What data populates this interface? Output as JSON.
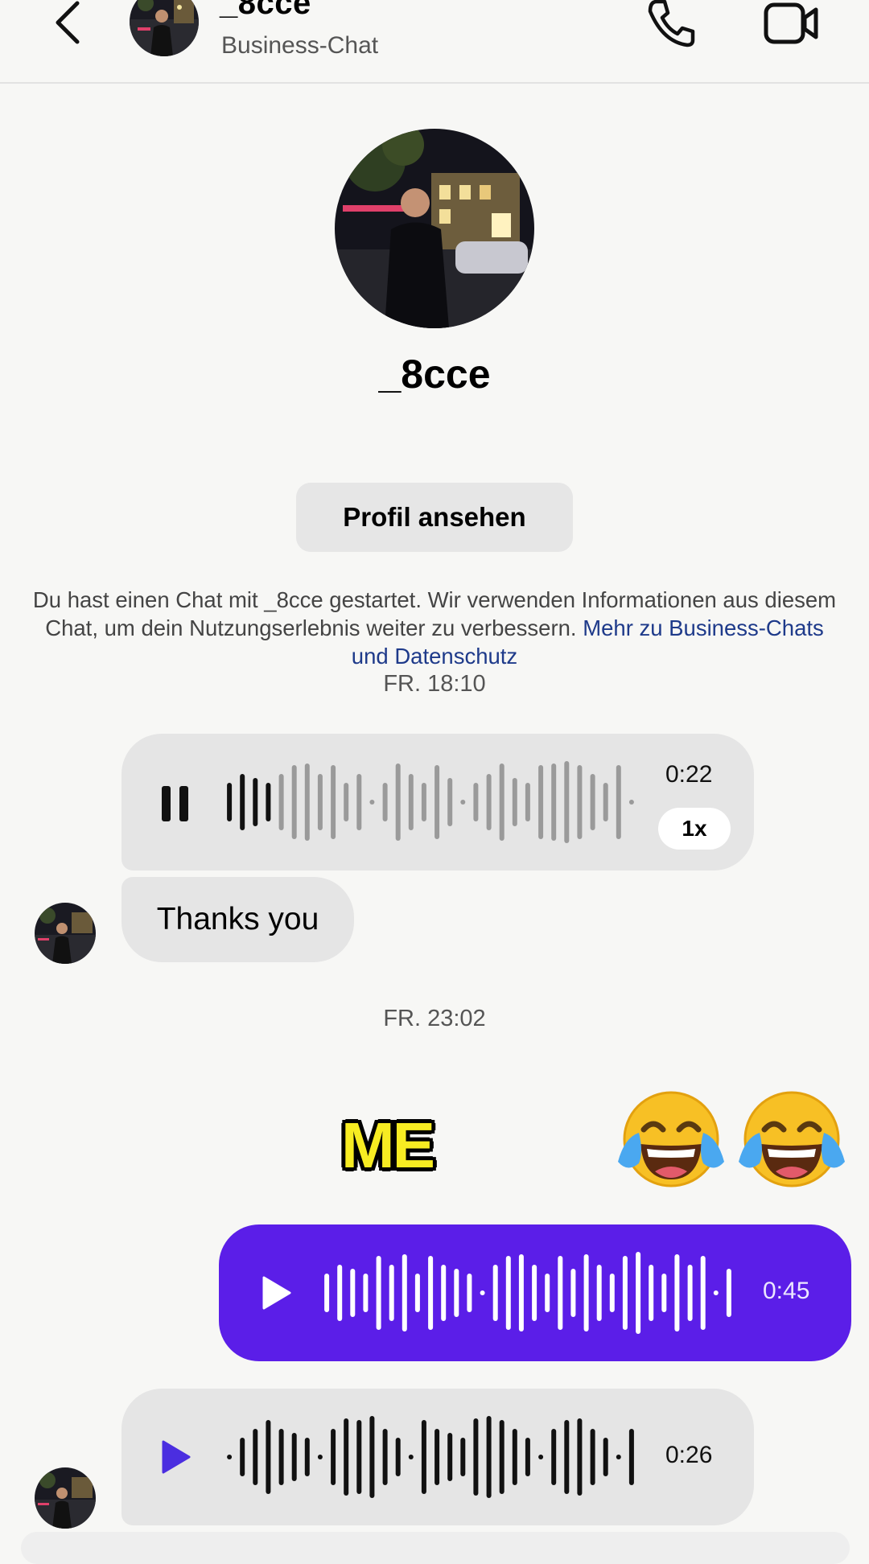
{
  "header": {
    "title": "_8cce",
    "subtitle": "Business-Chat",
    "back_icon": "chevron-left-icon",
    "call_icon": "phone-icon",
    "video_icon": "video-camera-icon"
  },
  "profile": {
    "name": "_8cce",
    "view_profile_label": "Profil ansehen",
    "info_text": "Du hast einen Chat mit _8cce gestartet. Wir verwenden Informationen aus diesem Chat, um dein Nutzungserlebnis weiter zu verbessern.",
    "info_link": "Mehr zu Business-Chats und Datenschutz"
  },
  "messages": {
    "timestamp_1": "FR. 18:10",
    "voice_1": {
      "duration": "0:22",
      "speed": "1x",
      "state": "playing",
      "progress": 0.1
    },
    "text_1": "Thanks you",
    "timestamp_2": "FR. 23:02",
    "voice_2": {
      "duration": "0:45",
      "state": "paused",
      "sender": "me"
    },
    "voice_3": {
      "duration": "0:26",
      "state": "paused"
    }
  },
  "overlay": {
    "label": "ME",
    "emoji_icon": "face-with-tears-of-joy-icon"
  },
  "colors": {
    "background": "#f7f7f5",
    "incoming_bubble": "#e5e5e5",
    "outgoing_bubble": "#5b1ee8",
    "link": "#1e3a8a",
    "play_icon_incoming": "#4b2ee0",
    "overlay_text": "#f7ec22"
  }
}
